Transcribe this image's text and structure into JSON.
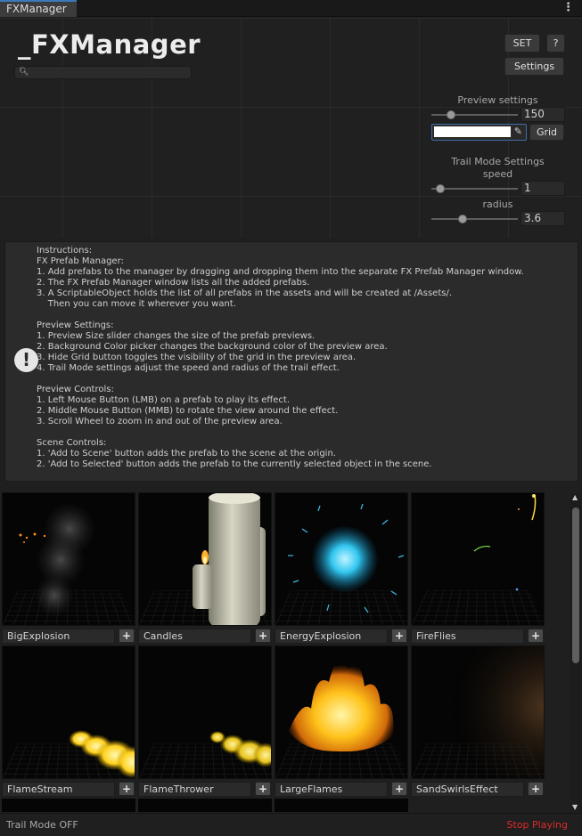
{
  "window": {
    "tab_label": "FXManager",
    "menu_icon": "kebab-menu-icon"
  },
  "header": {
    "title": "_FXManager",
    "search": {
      "value": "",
      "placeholder": "",
      "icon": "search-icon"
    },
    "buttons": {
      "set": "SET",
      "help": "?",
      "settings": "Settings"
    }
  },
  "preview_settings": {
    "label": "Preview settings",
    "size_slider": {
      "value": 150,
      "range": [
        50,
        500
      ]
    },
    "size_value": "150",
    "background_color": "#ffffff",
    "eyedropper_icon": "eyedropper-icon",
    "grid_button": "Grid"
  },
  "trail_mode": {
    "label": "Trail Mode Settings",
    "speed_label": "speed",
    "speed_value": "1",
    "speed_slider": {
      "value": 1,
      "range": [
        0,
        10
      ]
    },
    "radius_label": "radius",
    "radius_value": "3.6",
    "radius_slider": {
      "value": 3.6,
      "range": [
        0,
        10
      ]
    }
  },
  "instructions": {
    "icon": "warning-icon",
    "text": "Instructions:\nFX Prefab Manager:\n1. Add prefabs to the manager by dragging and dropping them into the separate FX Prefab Manager window.\n2. The FX Prefab Manager window lists all the added prefabs.\n3. A ScriptableObject holds the list of all prefabs in the assets and will be created at /Assets/.\n    Then you can move it wherever you want.\n\nPreview Settings:\n1. Preview Size slider changes the size of the prefab previews.\n2. Background Color picker changes the background color of the preview area.\n3. Hide Grid button toggles the visibility of the grid in the preview area.\n4. Trail Mode settings adjust the speed and radius of the trail effect.\n\nPreview Controls:\n1. Left Mouse Button (LMB) on a prefab to play its effect.\n2. Middle Mouse Button (MMB) to rotate the view around the effect.\n3. Scroll Wheel to zoom in and out of the preview area.\n\nScene Controls:\n1. 'Add to Scene' button adds the prefab to the scene at the origin.\n2. 'Add to Selected' button adds the prefab to the currently selected object in the scene."
  },
  "prefabs": [
    {
      "name": "BigExplosion",
      "add_label": "+"
    },
    {
      "name": "Candles",
      "add_label": "+"
    },
    {
      "name": "EnergyExplosion",
      "add_label": "+"
    },
    {
      "name": "FireFlies",
      "add_label": "+"
    },
    {
      "name": "FlameStream",
      "add_label": "+"
    },
    {
      "name": "FlameThrower",
      "add_label": "+"
    },
    {
      "name": "LargeFlames",
      "add_label": "+"
    },
    {
      "name": "SandSwirlsEffect",
      "add_label": "+"
    }
  ],
  "status": {
    "left": "Trail Mode OFF",
    "right": "Stop Playing",
    "right_color": "#e02a2a"
  }
}
